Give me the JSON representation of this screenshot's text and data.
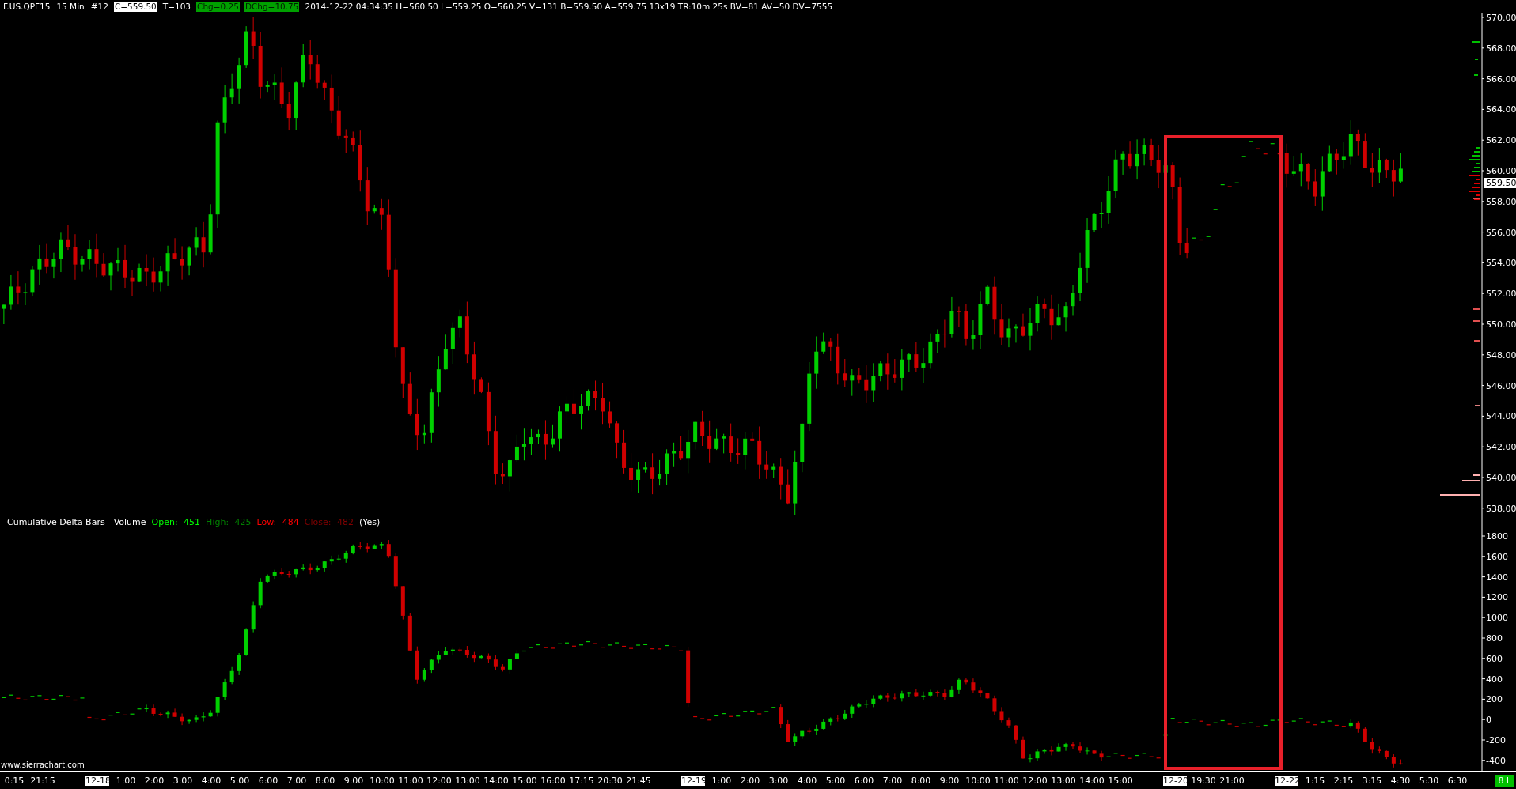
{
  "header": {
    "items": [
      {
        "text": "F.US.QPF15",
        "kind": "plain"
      },
      {
        "text": "15 Min",
        "kind": "plain"
      },
      {
        "text": "#12",
        "kind": "plain"
      },
      {
        "text": "C=559.50",
        "kind": "boxed"
      },
      {
        "text": "T=103",
        "kind": "plain"
      },
      {
        "text": "Chg=0.25",
        "kind": "green"
      },
      {
        "text": "DChg=10.75",
        "kind": "green"
      },
      {
        "text": "2014-12-22 04:34:35 H=560.50 L=559.25 O=560.25 V=131 B=559.50 A=559.75 13x19 TR:10m 25s BV=81 AV=50 DV=7555",
        "kind": "plain"
      }
    ]
  },
  "price_pane": {
    "axis_labels": [
      "570.00",
      "568.00",
      "566.00",
      "564.00",
      "562.00",
      "560.00",
      "558.00",
      "556.00",
      "554.00",
      "552.00",
      "550.00",
      "548.00",
      "546.00",
      "544.00",
      "542.00",
      "540.00",
      "538.00"
    ],
    "current_price": "559.50"
  },
  "indicator_pane": {
    "title": [
      {
        "text": "Cumulative Delta Bars - Volume",
        "color": "#ffffff"
      },
      {
        "text": "Open: -451",
        "color": "#00ff00"
      },
      {
        "text": "High: -425",
        "color": "#008000"
      },
      {
        "text": "Low: -484",
        "color": "#ff0000"
      },
      {
        "text": "Close: -482",
        "color": "#800000"
      },
      {
        "text": "(Yes)",
        "color": "#ffffff"
      }
    ],
    "axis_labels": [
      "1800",
      "1600",
      "1400",
      "1200",
      "1000",
      "800",
      "600",
      "400",
      "200",
      "0",
      "-200",
      "-400"
    ],
    "footer": "www.sierrachart.com"
  },
  "time_axis": {
    "labels": [
      {
        "text": "0:15",
        "kind": "time"
      },
      {
        "text": "21:15",
        "kind": "time"
      },
      {
        "text": "12-18",
        "kind": "date"
      },
      {
        "text": "1:00",
        "kind": "time"
      },
      {
        "text": "2:00",
        "kind": "time"
      },
      {
        "text": "3:00",
        "kind": "time"
      },
      {
        "text": "4:00",
        "kind": "time"
      },
      {
        "text": "5:00",
        "kind": "time"
      },
      {
        "text": "6:00",
        "kind": "time"
      },
      {
        "text": "7:00",
        "kind": "time"
      },
      {
        "text": "8:00",
        "kind": "time"
      },
      {
        "text": "9:00",
        "kind": "time"
      },
      {
        "text": "10:00",
        "kind": "time"
      },
      {
        "text": "11:00",
        "kind": "time"
      },
      {
        "text": "12:00",
        "kind": "time"
      },
      {
        "text": "13:00",
        "kind": "time"
      },
      {
        "text": "14:00",
        "kind": "time"
      },
      {
        "text": "15:00",
        "kind": "time"
      },
      {
        "text": "16:00",
        "kind": "time"
      },
      {
        "text": "17:15",
        "kind": "time"
      },
      {
        "text": "20:30",
        "kind": "time"
      },
      {
        "text": "21:45",
        "kind": "time"
      },
      {
        "text": "12-19",
        "kind": "date"
      },
      {
        "text": "1:00",
        "kind": "time"
      },
      {
        "text": "2:00",
        "kind": "time"
      },
      {
        "text": "3:00",
        "kind": "time"
      },
      {
        "text": "4:00",
        "kind": "time"
      },
      {
        "text": "5:00",
        "kind": "time"
      },
      {
        "text": "6:00",
        "kind": "time"
      },
      {
        "text": "7:00",
        "kind": "time"
      },
      {
        "text": "8:00",
        "kind": "time"
      },
      {
        "text": "9:00",
        "kind": "time"
      },
      {
        "text": "10:00",
        "kind": "time"
      },
      {
        "text": "11:00",
        "kind": "time"
      },
      {
        "text": "12:00",
        "kind": "time"
      },
      {
        "text": "13:00",
        "kind": "time"
      },
      {
        "text": "14:00",
        "kind": "time"
      },
      {
        "text": "15:00",
        "kind": "time"
      },
      {
        "text": "12-20",
        "kind": "date"
      },
      {
        "text": "19:30",
        "kind": "time"
      },
      {
        "text": "21:00",
        "kind": "time"
      },
      {
        "text": "12-22",
        "kind": "date"
      },
      {
        "text": "1:15",
        "kind": "time"
      },
      {
        "text": "2:15",
        "kind": "time"
      },
      {
        "text": "3:15",
        "kind": "time"
      },
      {
        "text": "4:30",
        "kind": "time"
      },
      {
        "text": "5:30",
        "kind": "time"
      },
      {
        "text": "6:30",
        "kind": "time"
      }
    ]
  },
  "status_badge": "8 L"
}
